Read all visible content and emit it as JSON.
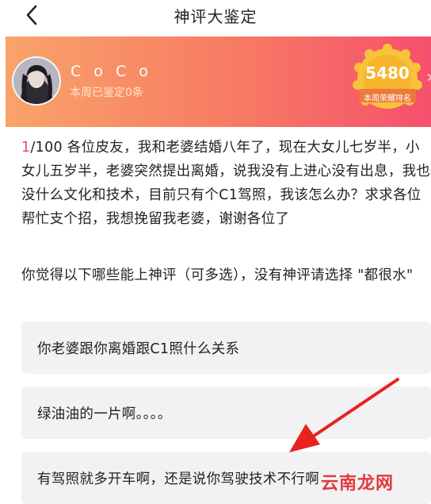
{
  "header": {
    "title": "神评大鉴定",
    "back_icon": "chevron-left-icon"
  },
  "profile": {
    "name": "C o C o",
    "subtitle": "本周已鉴定0条",
    "badge_number": "5480",
    "badge_label": "本周荣耀排名",
    "colors": {
      "gradient_start": "#f9a36a",
      "gradient_end": "#f5506d",
      "badge": "#f8c23a"
    }
  },
  "question": {
    "index": "1",
    "total": "/100",
    "text": " 各位皮友，我和老婆结婚八年了，现在大女儿七岁半，小女儿五岁半，老婆突然提出离婚，说我没有上进心没有出息，我也没什么文化和技术，目前只有个C1驾照，我该怎么办？求求各位帮忙支个招，我想挽留我老婆，谢谢各位了"
  },
  "instruction": "你觉得以下哪些能上神评（可多选），没有神评请选择 \"都很水\"",
  "options": [
    {
      "label": "你老婆跟你离婚跟C1照什么关系"
    },
    {
      "label": "绿油油的一片啊。。。。"
    },
    {
      "label": "有驾照就多开车啊，还是说你驾驶技术不行啊"
    }
  ],
  "watermark": "云南龙网",
  "accent_color": "#f0445d"
}
